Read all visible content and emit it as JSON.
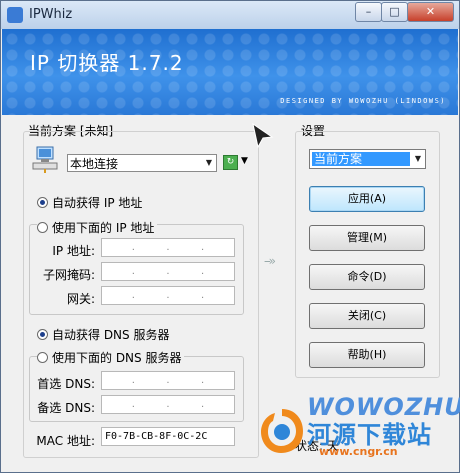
{
  "window": {
    "title": "IPWhiz",
    "min_label": "–",
    "max_label": "□",
    "close_label": "✕"
  },
  "banner": {
    "title": "IP 切换器 1.7.2",
    "credit": "DESIGNED BY WOWOZHU (LINDOWS)"
  },
  "scheme": {
    "label": "当前方案 [未知]",
    "connection": "本地连接"
  },
  "ip": {
    "auto_label": "自动获得 IP 地址",
    "manual_label": "使用下面的 IP 地址",
    "auto_selected": true,
    "ip_label": "IP 地址:",
    "mask_label": "子网掩码:",
    "gateway_label": "网关:"
  },
  "dns": {
    "auto_label": "自动获得 DNS 服务器",
    "manual_label": "使用下面的 DNS 服务器",
    "auto_selected": true,
    "preferred_label": "首选 DNS:",
    "alternate_label": "备选 DNS:"
  },
  "mac": {
    "label": "MAC 地址:",
    "value": "F0-7B-CB-8F-0C-2C"
  },
  "settings": {
    "label": "设置",
    "selected": "当前方案",
    "buttons": {
      "apply": "应用(A)",
      "manage": "管理(M)",
      "command": "命令(D)",
      "close": "关闭(C)",
      "help": "帮助(H)"
    }
  },
  "status": {
    "text": "状态: 天"
  },
  "arrows": "--»",
  "watermark": {
    "brand": "WOWOZHU",
    "site_name": "河源下载站",
    "url": "www.cngr.cn"
  },
  "colors": {
    "banner": "#2a78d6",
    "selection": "#3399ff",
    "watermark_blue": "#2f86d8",
    "watermark_orange": "#e8741e"
  }
}
